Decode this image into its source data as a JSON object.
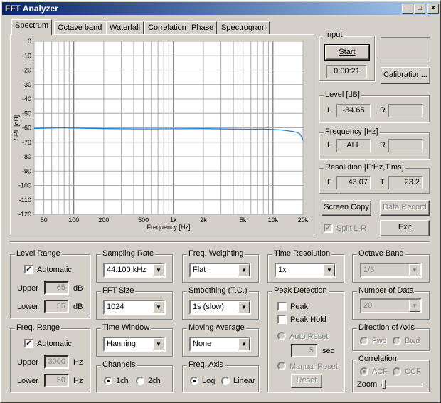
{
  "window": {
    "title": "FFT Analyzer",
    "min_label": "_",
    "max_label": "□",
    "close_label": "×"
  },
  "tabs": [
    {
      "label": "Spectrum"
    },
    {
      "label": "Octave band"
    },
    {
      "label": "Waterfall"
    },
    {
      "label": "Correlation"
    },
    {
      "label": "Phase"
    },
    {
      "label": "Spectrogram"
    }
  ],
  "chart_data": {
    "type": "line",
    "xlabel": "Frequency  [Hz]",
    "ylabel": "SPL [dB]",
    "x_scale": "log",
    "xlim": [
      40,
      20000
    ],
    "ylim": [
      -120,
      0
    ],
    "x_ticks": [
      "50",
      "100",
      "200",
      "500",
      "1k",
      "2k",
      "5k",
      "10k",
      "20k"
    ],
    "y_ticks": [
      "0",
      "-10",
      "-20",
      "-30",
      "-40",
      "-50",
      "-60",
      "-70",
      "-80",
      "-90",
      "-100",
      "-110",
      "-120"
    ],
    "grid": true,
    "series": [
      {
        "color": "#1e7fd8",
        "x": [
          40,
          60,
          80,
          100,
          200,
          500,
          1000,
          2000,
          4000,
          6000,
          8000,
          10000,
          12000,
          14000,
          16000,
          18000,
          19000,
          20000
        ],
        "y": [
          -60.5,
          -60.2,
          -60.0,
          -60.2,
          -60.6,
          -60.8,
          -60.7,
          -60.6,
          -60.9,
          -61.0,
          -60.9,
          -61.2,
          -61.5,
          -62.0,
          -62.6,
          -63.5,
          -65.0,
          -68.5
        ]
      }
    ]
  },
  "input": {
    "title": "Input",
    "start_label": "Start",
    "time": "0:00:21",
    "calibration_label": "Calibration..."
  },
  "level": {
    "title": "Level [dB]",
    "l_label": "L",
    "l_value": "-34.65",
    "r_label": "R",
    "r_value": ""
  },
  "frequency": {
    "title": "Frequency [Hz]",
    "l_label": "L",
    "l_value": "ALL",
    "r_label": "R",
    "r_value": ""
  },
  "resolution": {
    "title": "Resolution [F:Hz,T:ms]",
    "f_label": "F",
    "f_value": "43.07",
    "t_label": "T",
    "t_value": "23.2"
  },
  "buttons": {
    "screen_copy": "Screen Copy",
    "data_record": "Data Record",
    "split": "Split L-R",
    "exit": "Exit"
  },
  "level_range": {
    "title": "Level Range",
    "auto_label": "Automatic",
    "upper_label": "Upper",
    "upper_value": "65",
    "upper_unit": "dB",
    "lower_label": "Lower",
    "lower_value": "55",
    "lower_unit": "dB"
  },
  "freq_range": {
    "title": "Freq. Range",
    "auto_label": "Automatic",
    "upper_label": "Upper",
    "upper_value": "3000",
    "upper_unit": "Hz",
    "lower_label": "Lower",
    "lower_value": "50",
    "lower_unit": "Hz"
  },
  "sampling_rate": {
    "title": "Sampling Rate",
    "value": "44.100 kHz"
  },
  "fft_size": {
    "title": "FFT Size",
    "value": "1024"
  },
  "time_window": {
    "title": "Time Window",
    "value": "Hanning"
  },
  "channels": {
    "title": "Channels",
    "opt1": "1ch",
    "opt2": "2ch"
  },
  "freq_weighting": {
    "title": "Freq. Weighting",
    "value": "Flat"
  },
  "smoothing": {
    "title": "Smoothing (T.C.)",
    "value": "1s (slow)"
  },
  "moving_average": {
    "title": "Moving Average",
    "value": "None"
  },
  "freq_axis": {
    "title": "Freq. Axis",
    "opt1": "Log",
    "opt2": "Linear"
  },
  "time_resolution": {
    "title": "Time Resolution",
    "value": "1x"
  },
  "peak_detection": {
    "title": "Peak Detection",
    "peak_label": "Peak",
    "peak_hold_label": "Peak Hold",
    "auto_reset_label": "Auto Reset",
    "reset_value": "5",
    "reset_unit": "sec",
    "manual_reset_label": "Manual Reset",
    "reset_button": "Reset"
  },
  "octave_band": {
    "title": "Octave Band",
    "value": "1/3"
  },
  "number_of_data": {
    "title": "Number of Data",
    "value": "20"
  },
  "direction": {
    "title": "Direction of Axis",
    "opt1": "Fwd",
    "opt2": "Bwd"
  },
  "correlation": {
    "title": "Correlation",
    "opt1": "ACF",
    "opt2": "CCF",
    "zoom_label": "Zoom"
  }
}
